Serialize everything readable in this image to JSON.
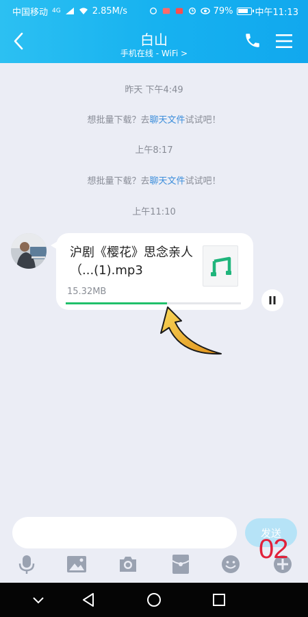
{
  "status_bar": {
    "carrier": "中国移动",
    "signal_type": "4G",
    "network_speed": "2.85M/s",
    "battery_percent": "79%",
    "time": "中午11:13"
  },
  "header": {
    "title": "白山",
    "subtitle": "手机在线 - WiFi >"
  },
  "messages": {
    "timestamp_1": "昨天 下午4:49",
    "tip_1_prefix": "想批量下载？去",
    "tip_1_link": "聊天文件",
    "tip_1_suffix": "试试吧！",
    "timestamp_2": "上午8:17",
    "tip_2_prefix": "想批量下载？去",
    "tip_2_link": "聊天文件",
    "tip_2_suffix": "试试吧！",
    "timestamp_3": "上午11:10"
  },
  "file_message": {
    "file_name": "沪剧《樱花》思念亲人（...(1).mp3",
    "file_size": "15.32MB",
    "download_progress": 0.58
  },
  "input_bar": {
    "placeholder": "",
    "send_label": "发送"
  },
  "overlay_text": "02",
  "colors": {
    "header_gradient_start": "#2cc0f2",
    "header_gradient_end": "#11a8ee",
    "link": "#3b8ddb",
    "progress": "#20c06a",
    "music_icon": "#1fb57c",
    "send_button": "#b6e3f7",
    "overlay": "#e1213a",
    "arrow_fill": "#f3b62d"
  },
  "icons": [
    "back-icon",
    "phone-icon",
    "menu-icon",
    "music-note-icon",
    "pause-icon",
    "mic-icon",
    "image-icon",
    "camera-icon",
    "red-packet-icon",
    "emoji-icon",
    "plus-icon",
    "nav-back-icon",
    "nav-home-icon",
    "nav-recents-icon"
  ]
}
